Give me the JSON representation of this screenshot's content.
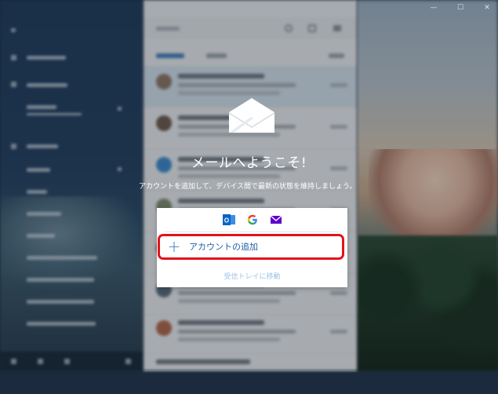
{
  "welcome": {
    "title": "メールへようこそ!",
    "subtitle": "アカウントを追加して、デバイス間で最新の状態を維持しましょう。"
  },
  "providers": [
    {
      "name": "outlook",
      "icon": "outlook-icon",
      "color": "#0072c6"
    },
    {
      "name": "google",
      "icon": "google-icon",
      "color": "#4285f4"
    },
    {
      "name": "yahoo",
      "icon": "yahoo-mail-icon",
      "color": "#5f01d1"
    }
  ],
  "actions": {
    "add_account_label": "アカウントの追加",
    "go_to_inbox_label": "受信トレイに移動"
  },
  "colors": {
    "highlight": "#e0141c",
    "accent": "#1f5fa8"
  },
  "window_controls": {
    "minimize": "—",
    "maximize": "☐",
    "close": "✕"
  }
}
